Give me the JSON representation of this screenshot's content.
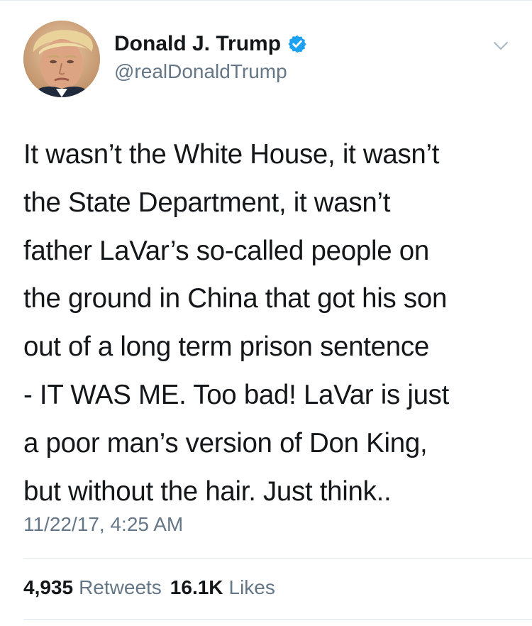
{
  "author": {
    "display_name": "Donald J. Trump",
    "handle": "@realDonaldTrump",
    "verified": true,
    "avatar_icon": "profile-photo",
    "verified_icon": "verified-badge-icon",
    "caret_icon": "chevron-down-icon"
  },
  "tweet": {
    "lines": [
      "It wasn’t the White House, it wasn’t",
      "the State Department, it wasn’t",
      "father LaVar’s so-called people on",
      "the ground in China that got his son",
      "out of a long term prison sentence",
      "- IT WAS ME. Too bad! LaVar is just",
      "a poor man’s version of Don King,",
      "but without the hair. Just think.."
    ],
    "timestamp": "11/22/17, 4:25 AM"
  },
  "stats": {
    "retweets_count": "4,935",
    "retweets_label": "Retweets",
    "likes_count": "16.1K",
    "likes_label": "Likes"
  },
  "colors": {
    "text": "#14171a",
    "secondary_text": "#657786",
    "verified_blue": "#1da1f2",
    "divider": "#e1e8ed"
  }
}
